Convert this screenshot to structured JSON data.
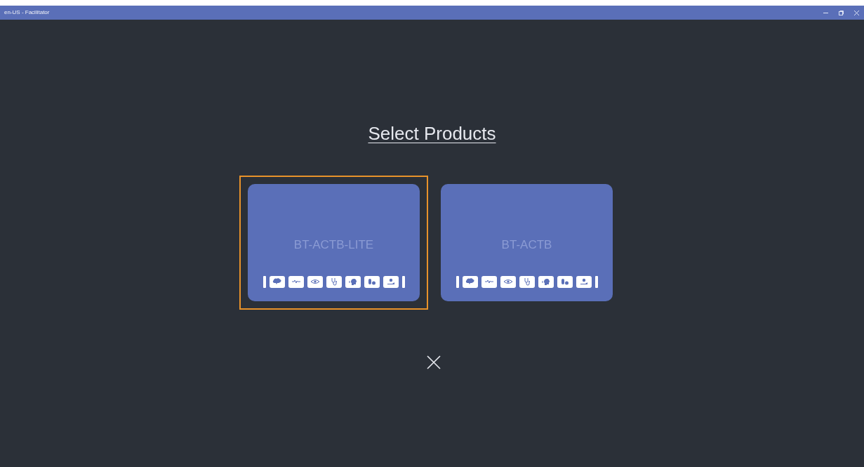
{
  "window": {
    "title": "en-US - Facilitator"
  },
  "heading": "Select Products",
  "products": [
    {
      "name": "BT-ACTB-LITE",
      "selected": true
    },
    {
      "name": "BT-ACTB",
      "selected": false
    }
  ]
}
